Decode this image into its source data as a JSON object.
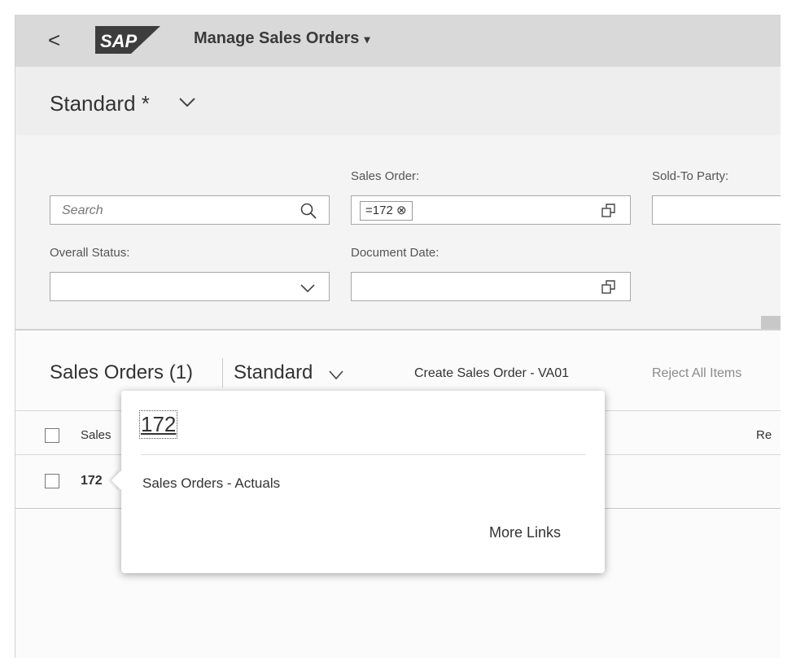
{
  "shell": {
    "back_glyph": "<",
    "logo_text": "SAP",
    "app_title": "Manage Sales Orders",
    "title_caret": "▾"
  },
  "variant": {
    "title": "Standard *"
  },
  "filters": {
    "search_placeholder": "Search",
    "sales_order_label": "Sales Order:",
    "sales_order_token": "=172 ⊗",
    "sold_to_label": "Sold-To Party:",
    "overall_status_label": "Overall Status:",
    "document_date_label": "Document Date:"
  },
  "table": {
    "title": "Sales Orders (1)",
    "variant": "Standard",
    "create_button": "Create Sales Order - VA01",
    "reject_button": "Reject All Items",
    "col_sales": "Sales",
    "col_re": "Re",
    "row_value": "172"
  },
  "popover": {
    "title": "172",
    "link": "Sales Orders - Actuals",
    "more_links": "More Links"
  }
}
